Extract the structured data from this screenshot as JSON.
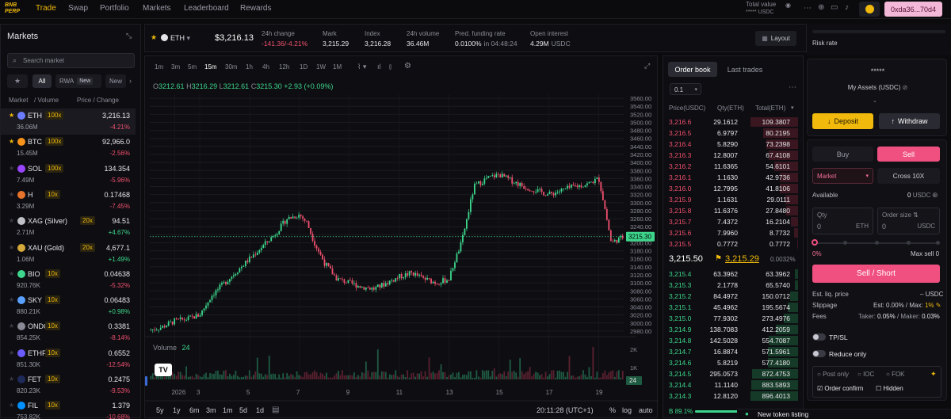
{
  "topbar": {
    "logo": "BNB PERP",
    "nav": [
      "Trade",
      "Swap",
      "Portfolio",
      "Markets",
      "Leaderboard",
      "Rewards"
    ],
    "total_value_label": "Total value",
    "total_value": "***** USDC",
    "wallet": "0xda36...70d4"
  },
  "markets": {
    "title": "Markets",
    "search_placeholder": "Search market",
    "filters": [
      "All",
      "RWA",
      "New",
      "New"
    ],
    "filter_new_badge": "New",
    "col_left": "Market",
    "col_mid": "/ Volume",
    "col_right": "Price / Change",
    "rows": [
      {
        "sym": "ETH",
        "lev": "100x",
        "vol": "36.06M",
        "price": "3,216.13",
        "chg": "-4.21%",
        "up": false,
        "fav": true,
        "color": "#6b7cff"
      },
      {
        "sym": "BTC",
        "lev": "100x",
        "vol": "15.45M",
        "price": "92,966.0",
        "chg": "-2.56%",
        "up": false,
        "fav": true,
        "color": "#f7931a"
      },
      {
        "sym": "SOL",
        "lev": "100x",
        "vol": "7.49M",
        "price": "134.354",
        "chg": "-5.96%",
        "up": false,
        "fav": false,
        "color": "#9945ff"
      },
      {
        "sym": "H",
        "lev": "10x",
        "vol": "3.29M",
        "price": "0.17468",
        "chg": "-7.45%",
        "up": false,
        "fav": false,
        "color": "#e8742b"
      },
      {
        "sym": "XAG (Silver)",
        "lev": "20x",
        "vol": "2.71M",
        "price": "94.51",
        "chg": "+4.67%",
        "up": true,
        "fav": false,
        "color": "#c0c0c8"
      },
      {
        "sym": "XAU (Gold)",
        "lev": "20x",
        "vol": "1.06M",
        "price": "4,677.1",
        "chg": "+1.49%",
        "up": true,
        "fav": false,
        "color": "#d4a83a"
      },
      {
        "sym": "BIO",
        "lev": "10x",
        "vol": "920.76K",
        "price": "0.04638",
        "chg": "-5.32%",
        "up": false,
        "fav": false,
        "color": "#3dd68c"
      },
      {
        "sym": "SKY",
        "lev": "10x",
        "vol": "880.21K",
        "price": "0.06483",
        "chg": "+0.98%",
        "up": true,
        "fav": false,
        "color": "#5aa0ff"
      },
      {
        "sym": "ONDO",
        "lev": "10x",
        "vol": "854.25K",
        "price": "0.3381",
        "chg": "-8.14%",
        "up": false,
        "fav": false,
        "color": "#8a8a96"
      },
      {
        "sym": "ETHFI",
        "lev": "10x",
        "vol": "851.30K",
        "price": "0.6552",
        "chg": "-12.54%",
        "up": false,
        "fav": false,
        "color": "#6b5cff"
      },
      {
        "sym": "FET",
        "lev": "10x",
        "vol": "820.23K",
        "price": "0.2475",
        "chg": "-9.53%",
        "up": false,
        "fav": false,
        "color": "#1e2a5a"
      },
      {
        "sym": "FIL",
        "lev": "10x",
        "vol": "753.82K",
        "price": "1.379",
        "chg": "-10.68%",
        "up": false,
        "fav": false,
        "color": "#0090ff"
      }
    ]
  },
  "ticker": {
    "symbol": "ETH",
    "price": "$3,216.13",
    "stats": [
      {
        "label": "24h change",
        "value": "-141.36/-4.21%",
        "cls": "red"
      },
      {
        "label": "Mark",
        "value": "3,215.29",
        "cls": ""
      },
      {
        "label": "Index",
        "value": "3,216.28",
        "cls": ""
      },
      {
        "label": "24h volume",
        "value": "36.46M",
        "cls": ""
      },
      {
        "label": "Pred. funding rate",
        "value": "0.0100%",
        "sub": "in 04:48:24",
        "cls": ""
      },
      {
        "label": "Open interest",
        "value": "4.29M",
        "sub": "USDC",
        "cls": ""
      }
    ],
    "layout_button": "Layout"
  },
  "chart": {
    "timeframes": [
      "1m",
      "3m",
      "5m",
      "15m",
      "30m",
      "1h",
      "4h",
      "12h",
      "1D",
      "1W",
      "1M"
    ],
    "active_tf": "15m",
    "ohlc": {
      "O": "3212.61",
      "H": "3216.29",
      "L": "3212.61",
      "C": "3215.30",
      "chg": "+2.93 (+0.09%)"
    },
    "price_label": "3215.30",
    "volume_label": "Volume",
    "volume_value": "24",
    "vol_axis": [
      "2K",
      "1K",
      "24"
    ],
    "x_ticks": [
      "2026",
      "3",
      "5",
      "7",
      "9",
      "11",
      "13",
      "15",
      "17",
      "19"
    ],
    "ranges": [
      "5y",
      "1y",
      "6m",
      "3m",
      "1m",
      "5d",
      "1d"
    ],
    "time": "20:11:28 (UTC+1)",
    "scale_opts": [
      "%",
      "log",
      "auto"
    ]
  },
  "chart_data": {
    "type": "line",
    "title": "",
    "xlabel": "",
    "ylabel": "",
    "y_ticks": [
      3560,
      3540,
      3520,
      3500,
      3480,
      3460,
      3440,
      3420,
      3400,
      3380,
      3360,
      3340,
      3320,
      3300,
      3280,
      3260,
      3240,
      3220,
      3200,
      3180,
      3160,
      3140,
      3120,
      3100,
      3080,
      3060,
      3040,
      3020,
      3000,
      2980
    ],
    "y_labels": [
      "3560.00",
      "3540.00",
      "3520.00",
      "3500.00",
      "3480.00",
      "3460.00",
      "3440.00",
      "3420.00",
      "3400.00",
      "3380.00",
      "3360.00",
      "3340.00",
      "3320.00",
      "3300.00",
      "3280.00",
      "3260.00",
      "3240.00",
      "3220.00",
      "3200.00",
      "3180.00",
      "3160.00",
      "3140.00",
      "3120.00",
      "3100.00",
      "3080.00",
      "3060.00",
      "3040.00",
      "3020.00",
      "3000.00",
      "2980.00"
    ],
    "ylim": [
      2970,
      3570
    ],
    "x_range": [
      1,
      20
    ],
    "series": [
      {
        "x": [
          1,
          1.5,
          2,
          2.5,
          3,
          3.5,
          4,
          4.5,
          5,
          5.5,
          6,
          6.5,
          7,
          7.3,
          7.6,
          8,
          8.5,
          9,
          9.5,
          10,
          10.5,
          11,
          11.5,
          12,
          12.5,
          13,
          13.2,
          13.5,
          14,
          14.5,
          15,
          15.5,
          16,
          16.5,
          17,
          17.5,
          18,
          18.5,
          19,
          19.2,
          19.5,
          20
        ],
        "values": [
          2982,
          2990,
          3005,
          3010,
          3020,
          3070,
          3100,
          3130,
          3160,
          3190,
          3220,
          3260,
          3270,
          3250,
          3200,
          3150,
          3110,
          3100,
          3090,
          3085,
          3100,
          3115,
          3125,
          3110,
          3100,
          3110,
          3150,
          3200,
          3340,
          3360,
          3370,
          3355,
          3340,
          3330,
          3320,
          3330,
          3340,
          3345,
          3360,
          3300,
          3200,
          3215
        ]
      }
    ]
  },
  "orderbook": {
    "tabs": [
      "Order book",
      "Last trades"
    ],
    "tick": "0.1",
    "cols": [
      "Price(USDC)",
      "Qty(ETH)",
      "Total(ETH)"
    ],
    "asks": [
      [
        "3,216.6",
        "29.1612",
        "109.3807",
        1.0
      ],
      [
        "3,216.5",
        "6.9797",
        "80.2195",
        0.73
      ],
      [
        "3,216.4",
        "5.8290",
        "73.2398",
        0.67
      ],
      [
        "3,216.3",
        "12.8007",
        "67.4108",
        0.62
      ],
      [
        "3,216.2",
        "11.6365",
        "54.6101",
        0.5
      ],
      [
        "3,216.1",
        "1.1630",
        "42.9736",
        0.39
      ],
      [
        "3,216.0",
        "12.7995",
        "41.8106",
        0.38
      ],
      [
        "3,215.9",
        "1.1631",
        "29.0111",
        0.27
      ],
      [
        "3,215.8",
        "11.6376",
        "27.8480",
        0.25
      ],
      [
        "3,215.7",
        "7.4372",
        "16.2104",
        0.15
      ],
      [
        "3,215.6",
        "7.9960",
        "8.7732",
        0.08
      ],
      [
        "3,215.5",
        "0.7772",
        "0.7772",
        0.01
      ]
    ],
    "mid_price": "3,215.50",
    "mark_price": "3,215.29",
    "spread": "0.0032%",
    "bids": [
      [
        "3,215.4",
        "63.3962",
        "63.3962",
        0.07
      ],
      [
        "3,215.3",
        "2.1778",
        "65.5740",
        0.07
      ],
      [
        "3,215.2",
        "84.4972",
        "150.0712",
        0.17
      ],
      [
        "3,215.1",
        "45.4962",
        "195.5674",
        0.22
      ],
      [
        "3,215.0",
        "77.9302",
        "273.4976",
        0.3
      ],
      [
        "3,214.9",
        "138.7083",
        "412.2059",
        0.46
      ],
      [
        "3,214.8",
        "142.5028",
        "554.7087",
        0.62
      ],
      [
        "3,214.7",
        "16.8874",
        "571.5961",
        0.64
      ],
      [
        "3,214.6",
        "5.8219",
        "577.4180",
        0.64
      ],
      [
        "3,214.5",
        "295.0573",
        "872.4753",
        0.97
      ],
      [
        "3,214.4",
        "11.1140",
        "883.5893",
        0.98
      ],
      [
        "3,214.3",
        "12.8120",
        "896.4013",
        1.0
      ]
    ],
    "ratio_label": "B",
    "ratio_value": "89.1%"
  },
  "account": {
    "risk_rate": "Risk rate",
    "stars": "*****",
    "my_assets": "My Assets (USDC)",
    "deposit": "Deposit",
    "withdraw": "Withdraw"
  },
  "order": {
    "buy": "Buy",
    "sell": "Sell",
    "type": "Market",
    "margin": "Cross 10X",
    "available_label": "Available",
    "available_value": "0",
    "available_unit": "USDC",
    "qty_label": "Qty",
    "qty_value": "0",
    "qty_unit": "ETH",
    "size_label": "Order size",
    "size_value": "0",
    "size_unit": "USDC",
    "slider_value": "0%",
    "max_sell": "Max sell 0",
    "submit": "Sell / Short",
    "est_liq_label": "Est. liq. price",
    "est_liq_value": "– USDC",
    "slippage_label": "Slippage",
    "slippage_est": "Est: 0.00% / Max:",
    "slippage_max": "1%",
    "fees_label": "Fees",
    "fees_taker_label": "Taker:",
    "fees_taker_value": "0.05%",
    "fees_maker_label": "/ Maker:",
    "fees_maker_value": "0.03%",
    "tpsl": "TP/SL",
    "reduce_only": "Reduce only",
    "post_only": "Post only",
    "ioc": "IOC",
    "fok": "FOK",
    "order_confirm": "Order confirm",
    "hidden": "Hidden"
  },
  "toast": "New token listing"
}
